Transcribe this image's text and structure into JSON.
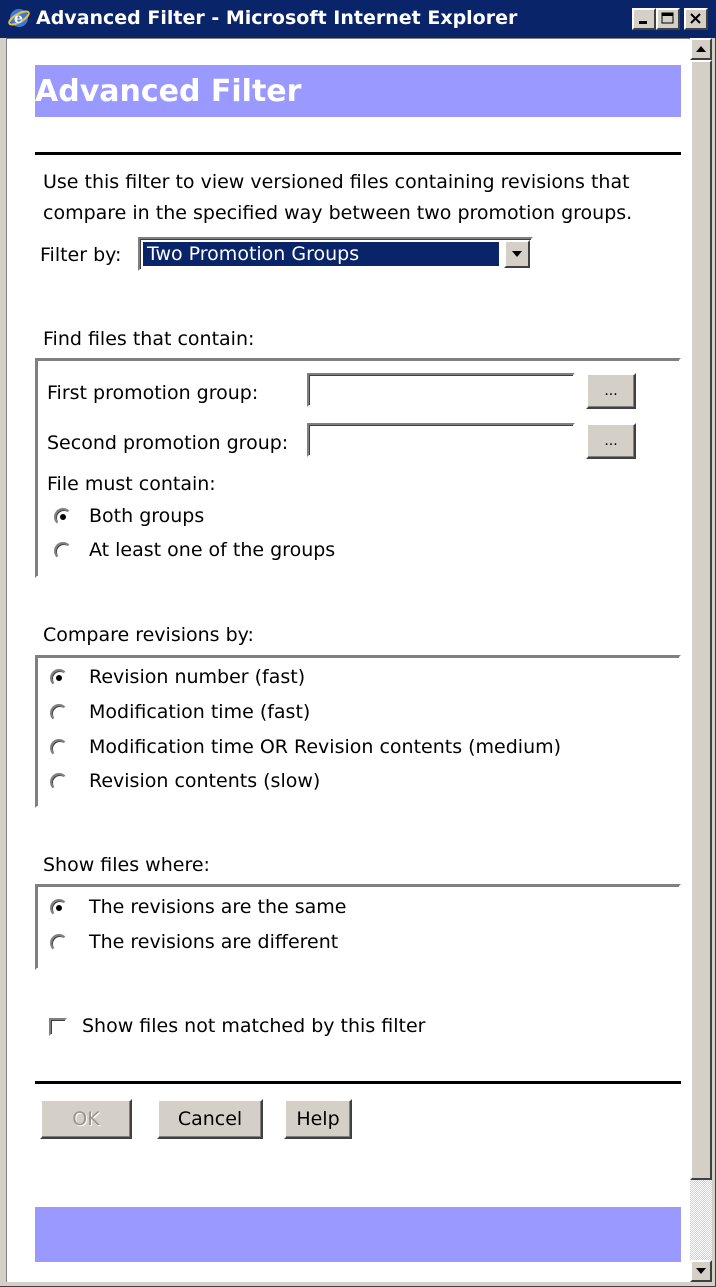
{
  "window": {
    "title": "Advanced Filter - Microsoft Internet Explorer"
  },
  "header": {
    "title": "Advanced Filter"
  },
  "intro": {
    "line1": "Use this filter to view versioned files containing revisions that",
    "line2": "compare in the specified way between two promotion groups."
  },
  "filter_by": {
    "label": "Filter by:",
    "selected": "Two Promotion Groups"
  },
  "find_files": {
    "heading": "Find files that contain:",
    "first_label": "First promotion group:",
    "first_value": "",
    "second_label": "Second promotion group:",
    "second_value": "",
    "browse_label": "...",
    "must_contain_label": "File must contain:",
    "options": [
      {
        "label": "Both groups",
        "selected": true
      },
      {
        "label": "At least one of the groups",
        "selected": false
      }
    ]
  },
  "compare": {
    "heading": "Compare revisions by:",
    "options": [
      {
        "label": "Revision number (fast)",
        "selected": true
      },
      {
        "label": "Modification time (fast)",
        "selected": false
      },
      {
        "label": "Modification time OR Revision contents (medium)",
        "selected": false
      },
      {
        "label": "Revision contents (slow)",
        "selected": false
      }
    ]
  },
  "show_files": {
    "heading": "Show files where:",
    "options": [
      {
        "label": "The revisions are the same",
        "selected": true
      },
      {
        "label": "The revisions are different",
        "selected": false
      }
    ]
  },
  "not_matched": {
    "label": "Show files not matched by this filter",
    "checked": false
  },
  "buttons": {
    "ok": "OK",
    "ok_enabled": false,
    "cancel": "Cancel",
    "help": "Help"
  },
  "colors": {
    "titlebar": "#0a246a",
    "banner": "#9999ff",
    "face": "#d4d0c8"
  }
}
